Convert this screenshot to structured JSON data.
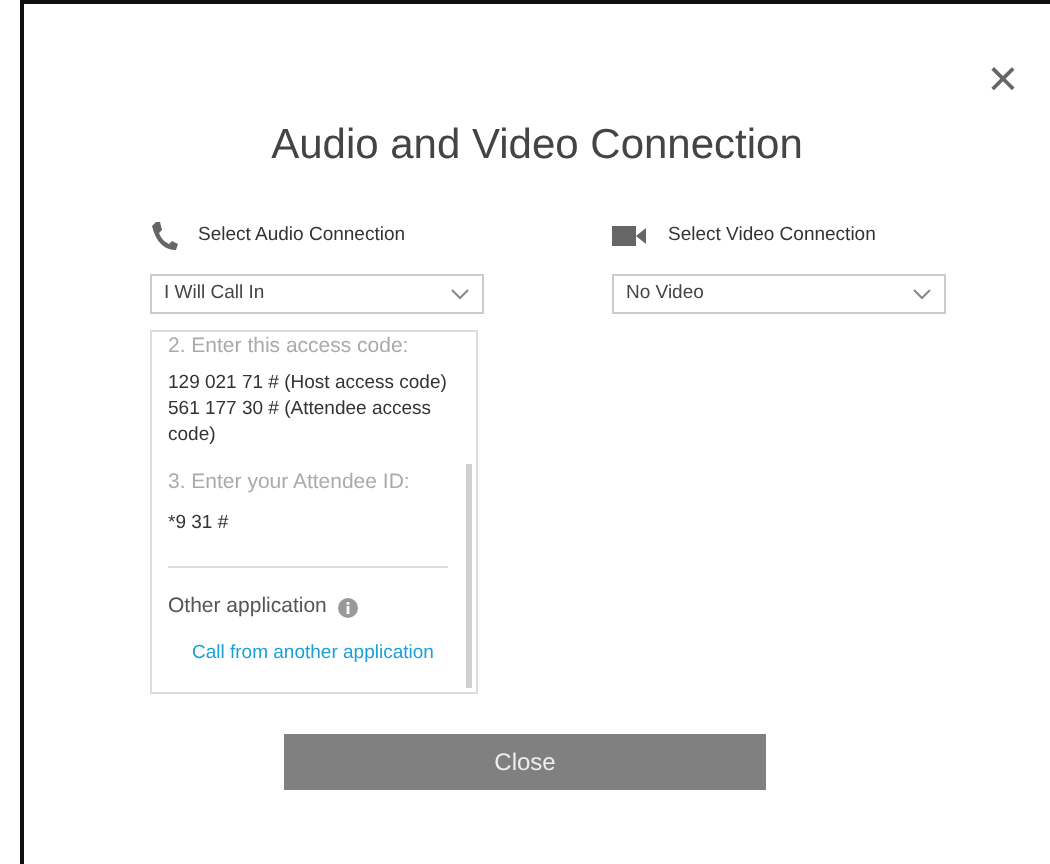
{
  "dialog": {
    "title": "Audio and Video Connection",
    "close_symbol": "×"
  },
  "audio": {
    "label": "Select Audio Connection",
    "value": "I Will Call In",
    "steps": [
      {
        "kind": "heading",
        "text": "2. Enter this access code:"
      },
      {
        "kind": "body",
        "text": "129 021 71 # (Host access code)"
      },
      {
        "kind": "body",
        "text": "561 177 30 # (Attendee access code)"
      },
      {
        "kind": "heading",
        "text": "3. Enter your Attendee ID:"
      },
      {
        "kind": "body",
        "text": "*9 31 #"
      }
    ],
    "other": {
      "label": "Other application",
      "link": "Call from another application"
    }
  },
  "video": {
    "label": "Select Video Connection",
    "value": "No Video"
  },
  "buttons": [
    {
      "label": "Close"
    }
  ]
}
